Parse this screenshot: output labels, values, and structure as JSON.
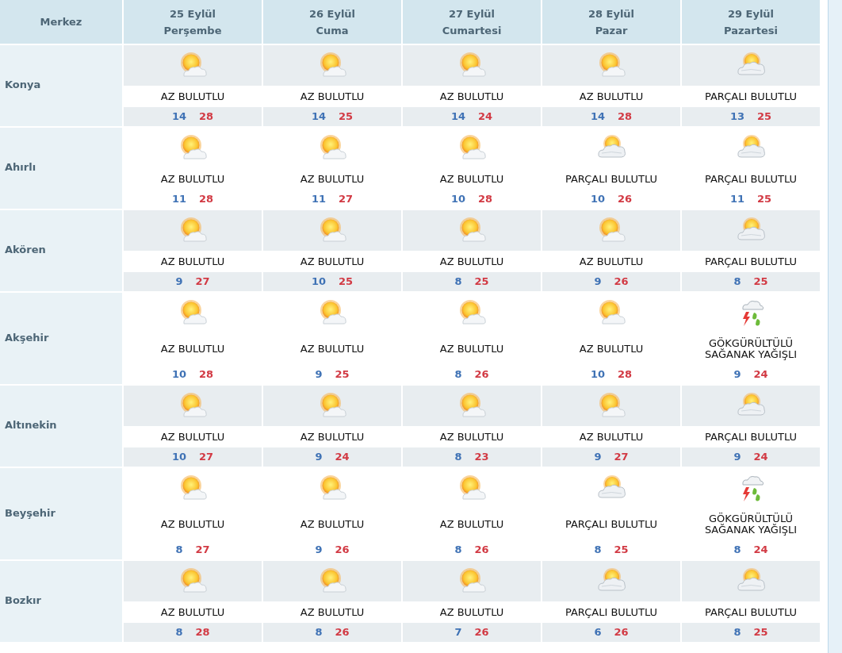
{
  "header": {
    "station_label": "Merkez",
    "days": [
      {
        "date": "25 Eylül",
        "weekday": "Perşembe"
      },
      {
        "date": "26 Eylül",
        "weekday": "Cuma"
      },
      {
        "date": "27 Eylül",
        "weekday": "Cumartesi"
      },
      {
        "date": "28 Eylül",
        "weekday": "Pazar"
      },
      {
        "date": "29 Eylül",
        "weekday": "Pazartesi"
      }
    ]
  },
  "rows": [
    {
      "name": "Konya",
      "forecasts": [
        {
          "kind": "sunny",
          "condition": "AZ BULUTLU",
          "low": "14",
          "high": "28"
        },
        {
          "kind": "sunny",
          "condition": "AZ BULUTLU",
          "low": "14",
          "high": "25"
        },
        {
          "kind": "sunny",
          "condition": "AZ BULUTLU",
          "low": "14",
          "high": "24"
        },
        {
          "kind": "sunny",
          "condition": "AZ BULUTLU",
          "low": "14",
          "high": "28"
        },
        {
          "kind": "cloudy",
          "condition": "PARÇALI BULUTLU",
          "low": "13",
          "high": "25"
        }
      ]
    },
    {
      "name": "Ahırlı",
      "forecasts": [
        {
          "kind": "sunny",
          "condition": "AZ BULUTLU",
          "low": "11",
          "high": "28"
        },
        {
          "kind": "sunny",
          "condition": "AZ BULUTLU",
          "low": "11",
          "high": "27"
        },
        {
          "kind": "sunny",
          "condition": "AZ BULUTLU",
          "low": "10",
          "high": "28"
        },
        {
          "kind": "cloudy",
          "condition": "PARÇALI BULUTLU",
          "low": "10",
          "high": "26"
        },
        {
          "kind": "cloudy",
          "condition": "PARÇALI BULUTLU",
          "low": "11",
          "high": "25"
        }
      ]
    },
    {
      "name": "Akören",
      "forecasts": [
        {
          "kind": "sunny",
          "condition": "AZ BULUTLU",
          "low": "9",
          "high": "27"
        },
        {
          "kind": "sunny",
          "condition": "AZ BULUTLU",
          "low": "10",
          "high": "25"
        },
        {
          "kind": "sunny",
          "condition": "AZ BULUTLU",
          "low": "8",
          "high": "25"
        },
        {
          "kind": "sunny",
          "condition": "AZ BULUTLU",
          "low": "9",
          "high": "26"
        },
        {
          "kind": "cloudy",
          "condition": "PARÇALI BULUTLU",
          "low": "8",
          "high": "25"
        }
      ]
    },
    {
      "name": "Akşehir",
      "forecasts": [
        {
          "kind": "sunny",
          "condition": "AZ BULUTLU",
          "low": "10",
          "high": "28"
        },
        {
          "kind": "sunny",
          "condition": "AZ BULUTLU",
          "low": "9",
          "high": "25"
        },
        {
          "kind": "sunny",
          "condition": "AZ BULUTLU",
          "low": "8",
          "high": "26"
        },
        {
          "kind": "sunny",
          "condition": "AZ BULUTLU",
          "low": "10",
          "high": "28"
        },
        {
          "kind": "storm",
          "condition": "GÖKGÜRÜLTÜLÜ SAĞANAK YAĞIŞLI",
          "low": "9",
          "high": "24"
        }
      ]
    },
    {
      "name": "Altınekin",
      "forecasts": [
        {
          "kind": "sunny",
          "condition": "AZ BULUTLU",
          "low": "10",
          "high": "27"
        },
        {
          "kind": "sunny",
          "condition": "AZ BULUTLU",
          "low": "9",
          "high": "24"
        },
        {
          "kind": "sunny",
          "condition": "AZ BULUTLU",
          "low": "8",
          "high": "23"
        },
        {
          "kind": "sunny",
          "condition": "AZ BULUTLU",
          "low": "9",
          "high": "27"
        },
        {
          "kind": "cloudy",
          "condition": "PARÇALI BULUTLU",
          "low": "9",
          "high": "24"
        }
      ]
    },
    {
      "name": "Beyşehir",
      "forecasts": [
        {
          "kind": "sunny",
          "condition": "AZ BULUTLU",
          "low": "8",
          "high": "27"
        },
        {
          "kind": "sunny",
          "condition": "AZ BULUTLU",
          "low": "9",
          "high": "26"
        },
        {
          "kind": "sunny",
          "condition": "AZ BULUTLU",
          "low": "8",
          "high": "26"
        },
        {
          "kind": "cloudy",
          "condition": "PARÇALI BULUTLU",
          "low": "8",
          "high": "25"
        },
        {
          "kind": "storm",
          "condition": "GÖKGÜRÜLTÜLÜ SAĞANAK YAĞIŞLI",
          "low": "8",
          "high": "24"
        }
      ]
    },
    {
      "name": "Bozkır",
      "forecasts": [
        {
          "kind": "sunny",
          "condition": "AZ BULUTLU",
          "low": "8",
          "high": "28"
        },
        {
          "kind": "sunny",
          "condition": "AZ BULUTLU",
          "low": "8",
          "high": "26"
        },
        {
          "kind": "sunny",
          "condition": "AZ BULUTLU",
          "low": "7",
          "high": "26"
        },
        {
          "kind": "cloudy",
          "condition": "PARÇALI BULUTLU",
          "low": "6",
          "high": "26"
        },
        {
          "kind": "cloudy",
          "condition": "PARÇALI BULUTLU",
          "low": "8",
          "high": "25"
        }
      ]
    }
  ]
}
